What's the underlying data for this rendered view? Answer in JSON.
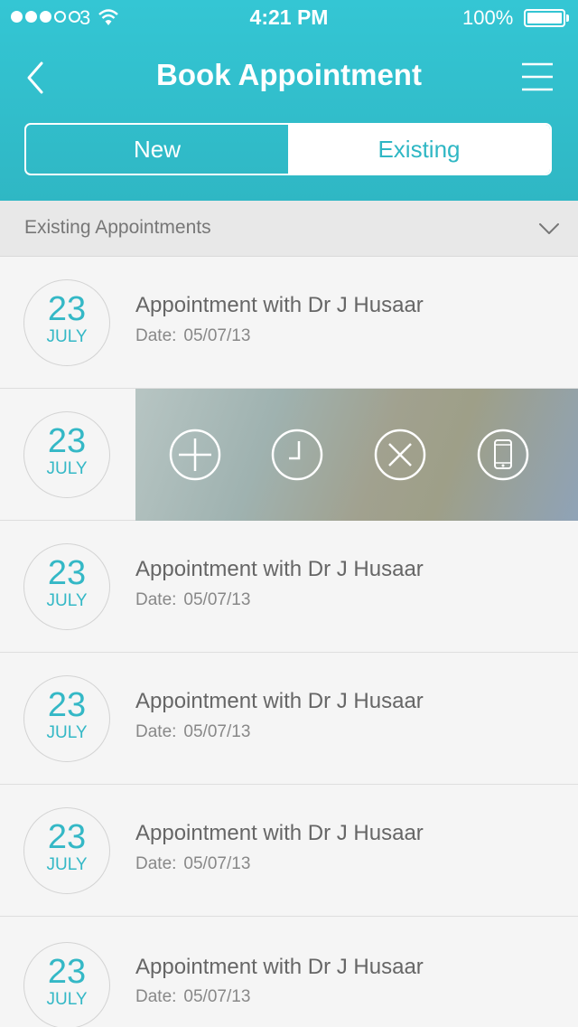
{
  "status_bar": {
    "signal_dots": [
      true,
      true,
      true,
      false,
      false
    ],
    "carrier": "3",
    "time": "4:21 PM",
    "battery": "100%"
  },
  "nav": {
    "title": "Book Appointment",
    "back_icon": "chevron-left-icon",
    "menu_icon": "hamburger-menu-icon"
  },
  "segments": {
    "new_label": "New",
    "existing_label": "Existing",
    "selected": "Existing"
  },
  "section": {
    "title": "Existing Appointments",
    "chevron_icon": "chevron-down-icon"
  },
  "appointments": [
    {
      "day": "23",
      "month": "JULY",
      "title": "Appointment with Dr J Husaar",
      "date_label": "Date:",
      "date": "05/07/13"
    },
    {
      "day": "23",
      "month": "JULY",
      "swiped": true,
      "actions": [
        "plus-circle-icon",
        "clock-icon",
        "close-circle-icon",
        "phone-icon"
      ]
    },
    {
      "day": "23",
      "month": "JULY",
      "title": "Appointment with Dr J Husaar",
      "date_label": "Date:",
      "date": "05/07/13"
    },
    {
      "day": "23",
      "month": "JULY",
      "title": "Appointment with Dr J Husaar",
      "date_label": "Date:",
      "date": "05/07/13"
    },
    {
      "day": "23",
      "month": "JULY",
      "title": "Appointment with Dr J Husaar",
      "date_label": "Date:",
      "date": "05/07/13"
    },
    {
      "day": "23",
      "month": "JULY",
      "title": "Appointment with Dr J Husaar",
      "date_label": "Date:",
      "date": "05/07/13"
    }
  ],
  "colors": {
    "accent": "#2fb7c4",
    "header_top": "#34c6d4",
    "text_primary": "#666666",
    "text_secondary": "#888888"
  }
}
